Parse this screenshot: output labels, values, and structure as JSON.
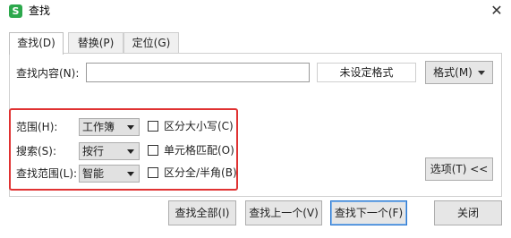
{
  "window": {
    "title": "查找",
    "app_icon_letter": "S",
    "close_glyph": "✕"
  },
  "tabs": [
    {
      "label": "查找(D)",
      "active": true
    },
    {
      "label": "替换(P)",
      "active": false
    },
    {
      "label": "定位(G)",
      "active": false
    }
  ],
  "find": {
    "label": "查找内容(N):",
    "value": "",
    "format_status": "未设定格式",
    "format_button": "格式(M)"
  },
  "options": {
    "range": {
      "label": "范围(H):",
      "value": "工作簿"
    },
    "search": {
      "label": "搜索(S):",
      "value": "按行"
    },
    "look_in": {
      "label": "查找范围(L):",
      "value": "智能"
    },
    "match_case": {
      "label": "区分大小写(C)",
      "checked": false
    },
    "match_cell": {
      "label": "单元格匹配(O)",
      "checked": false
    },
    "match_width": {
      "label": "区分全/半角(B)",
      "checked": false
    },
    "toggle_button": "选项(T) <<"
  },
  "actions": {
    "find_all": "查找全部(I)",
    "find_prev": "查找上一个(V)",
    "find_next": "查找下一个(F)",
    "close": "关闭"
  },
  "colors": {
    "highlight_border": "#e03232",
    "app_icon": "#2ca84c",
    "primary_border": "#2b78d0"
  }
}
